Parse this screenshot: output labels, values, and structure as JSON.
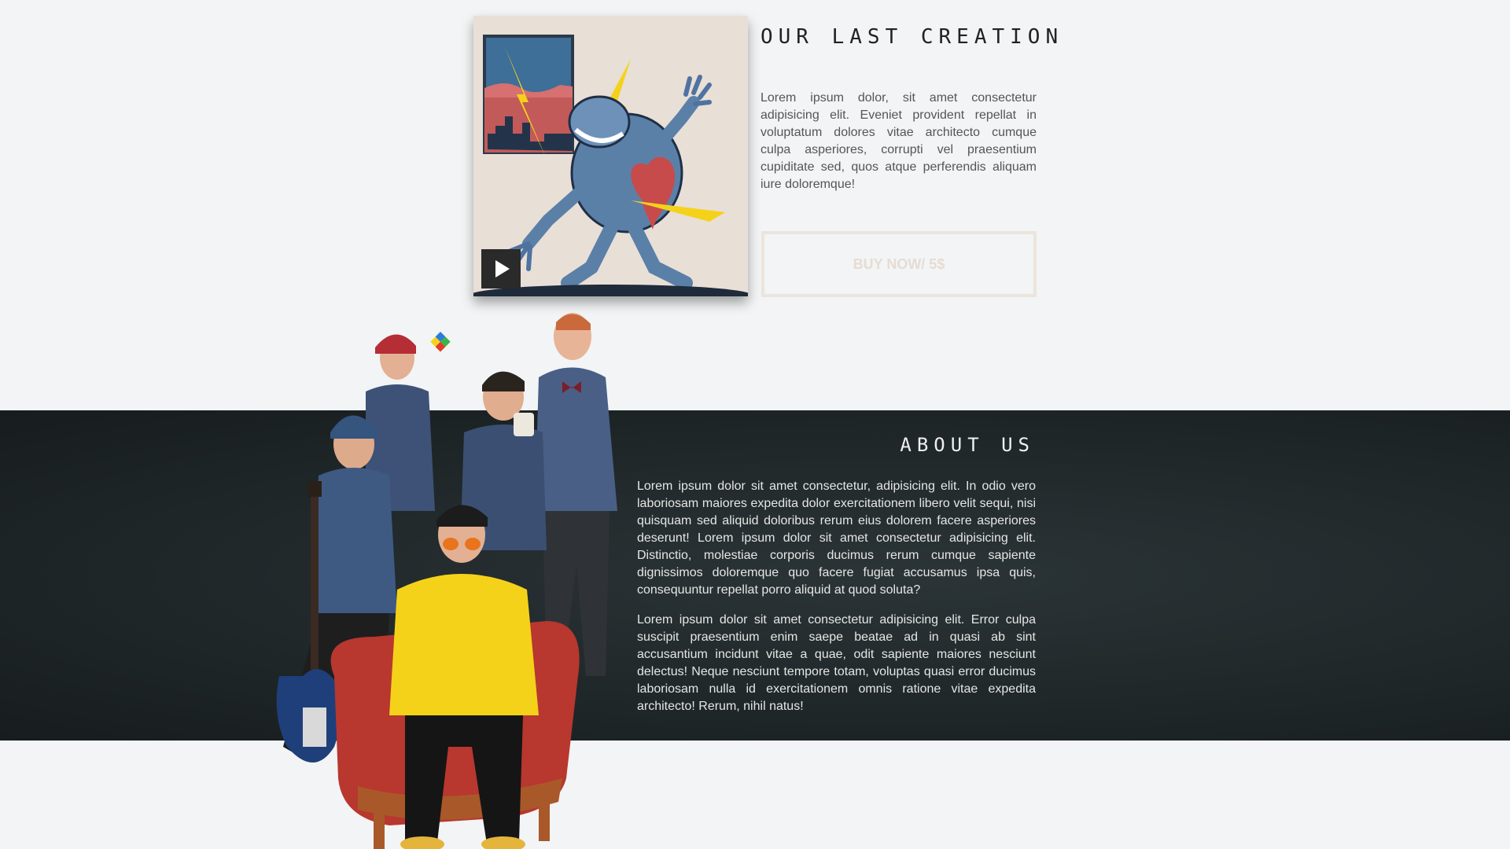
{
  "creation": {
    "title": "OUR LAST CREATION",
    "text": "Lorem ipsum dolor, sit amet consectetur adipisicing elit. Eveniet provident repellat in voluptatum dolores vitae architecto cumque culpa asperiores, corrupti vel praesentium cupiditate sed, quos atque perferendis aliquam iure doloremque!",
    "buy_label": "BUY NOW/ 5$",
    "album_icon": "play-icon"
  },
  "about": {
    "title": "ABOUT US",
    "paragraph1": "Lorem ipsum dolor sit amet consectetur, adipisicing elit. In odio vero laboriosam maiores expedita dolor exercitationem libero velit sequi, nisi quisquam sed aliquid doloribus rerum eius dolorem facere asperiores deserunt! Lorem ipsum dolor sit amet consectetur adipisicing elit. Distinctio, molestiae corporis ducimus rerum cumque sapiente dignissimos doloremque quo facere fugiat accusamus ipsa quis, consequuntur repellat porro aliquid at quod soluta?",
    "paragraph2": "Lorem ipsum dolor sit amet consectetur adipisicing elit. Error culpa suscipit praesentium enim saepe beatae ad in quasi ab sint accusantium incidunt vitae a quae, odit sapiente maiores nesciunt delectus! Neque nesciunt tempore totam, voluptas quasi error ducimus laboriosam nulla id exercitationem omnis ratione vitae expedita architecto! Rerum, nihil natus!"
  },
  "colors": {
    "page_bg": "#f2f4f5",
    "dark_band": "#1d2426",
    "accent_yellow": "#f5d21a",
    "button_border": "#ece4dc"
  }
}
